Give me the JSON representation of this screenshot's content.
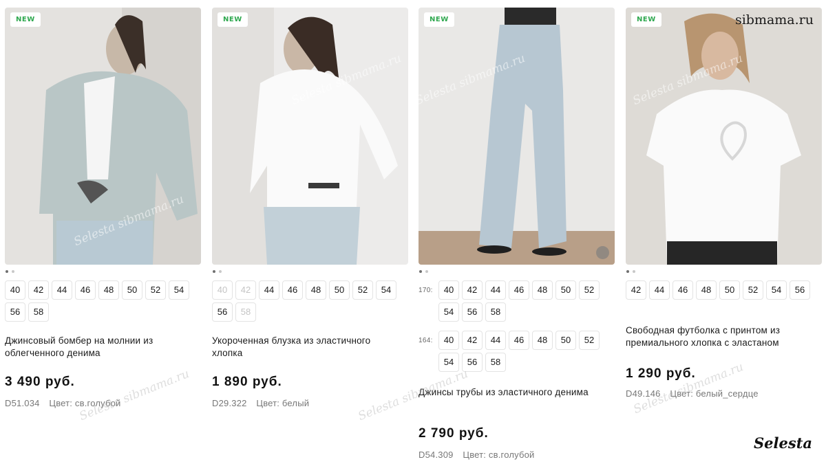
{
  "products": [
    {
      "badge": "NEW",
      "title": "Джинсовый бомбер на молнии из облегченного денима",
      "price": "3 490 руб.",
      "sku": "D51.034",
      "color": "Цвет: св.голубой",
      "sizes": [
        {
          "label": "40",
          "available": true
        },
        {
          "label": "42",
          "available": true
        },
        {
          "label": "44",
          "available": true
        },
        {
          "label": "46",
          "available": true
        },
        {
          "label": "48",
          "available": true
        },
        {
          "label": "50",
          "available": true
        },
        {
          "label": "52",
          "available": true
        },
        {
          "label": "54",
          "available": true
        },
        {
          "label": "56",
          "available": true
        },
        {
          "label": "58",
          "available": true
        }
      ]
    },
    {
      "badge": "NEW",
      "title": "Укороченная блузка из эластичного хлопка",
      "price": "1 890 руб.",
      "sku": "D29.322",
      "color": "Цвет: белый",
      "sizes": [
        {
          "label": "40",
          "available": false
        },
        {
          "label": "42",
          "available": false
        },
        {
          "label": "44",
          "available": true
        },
        {
          "label": "46",
          "available": true
        },
        {
          "label": "48",
          "available": true
        },
        {
          "label": "50",
          "available": true
        },
        {
          "label": "52",
          "available": true
        },
        {
          "label": "54",
          "available": true
        },
        {
          "label": "56",
          "available": true
        },
        {
          "label": "58",
          "available": false
        }
      ]
    },
    {
      "badge": "NEW",
      "title": "Джинсы трубы из эластичного денима",
      "price": "2 790 руб.",
      "sku": "D54.309",
      "color": "Цвет: св.голубой",
      "heights": [
        {
          "label": "170:",
          "sizes": [
            "40",
            "42",
            "44",
            "46",
            "48",
            "50",
            "52",
            "54",
            "56",
            "58"
          ]
        },
        {
          "label": "164:",
          "sizes": [
            "40",
            "42",
            "44",
            "46",
            "48",
            "50",
            "52",
            "54",
            "56",
            "58"
          ]
        }
      ]
    },
    {
      "badge": "NEW",
      "title": "Свободная футболка с принтом из премиального хлопка с эластаном",
      "price": "1 290 руб.",
      "sku": "D49.146",
      "color": "Цвет: белый_сердце",
      "sizes": [
        {
          "label": "42",
          "available": true
        },
        {
          "label": "44",
          "available": true
        },
        {
          "label": "46",
          "available": true
        },
        {
          "label": "48",
          "available": true
        },
        {
          "label": "50",
          "available": true
        },
        {
          "label": "52",
          "available": true
        },
        {
          "label": "54",
          "available": true
        },
        {
          "label": "56",
          "available": true
        }
      ]
    }
  ],
  "watermarks": {
    "site": "sibmama.ru",
    "brand": "Selesta",
    "overlay": "Selesta sibmama.ru"
  }
}
